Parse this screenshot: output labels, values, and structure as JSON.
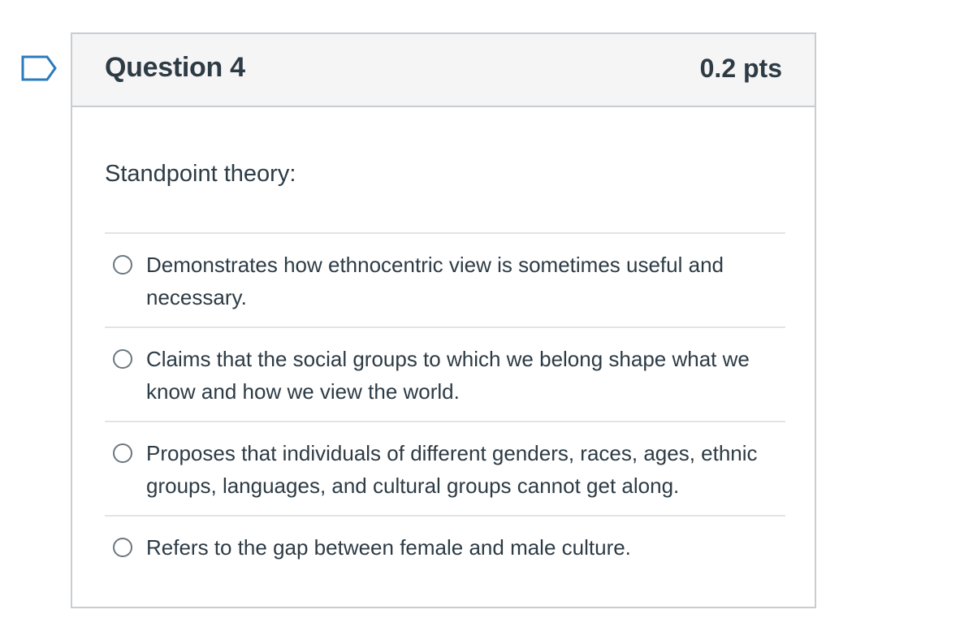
{
  "flag": {
    "icon": "flag-outline-icon",
    "color": "#2b7abc"
  },
  "question": {
    "title": "Question 4",
    "points": "0.2 pts",
    "text": "Standpoint theory:",
    "answers": [
      {
        "label": "Demonstrates how ethnocentric view is sometimes useful and necessary."
      },
      {
        "label": "Claims that the social groups to which we belong shape what we know and how we view the world."
      },
      {
        "label": "Proposes that individuals of different genders, races, ages, ethnic groups, languages, and cultural groups cannot get along."
      },
      {
        "label": "Refers to the gap between female and male culture."
      }
    ]
  },
  "colors": {
    "text": "#2d3b45",
    "border": "#c7cdd1",
    "header_bg": "#f5f5f5",
    "divider": "#e0e4e6",
    "flag": "#2b7abc"
  }
}
